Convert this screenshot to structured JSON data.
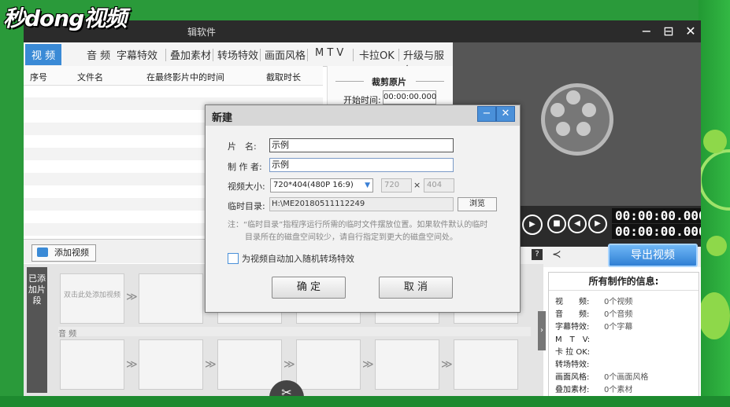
{
  "app": {
    "title": "(partial) 编辑软件",
    "title_visible": "辑软件",
    "logo": "秒d",
    "logo_text": "秒dong视频",
    "window_controls": [
      "−",
      "⊟",
      "✕"
    ]
  },
  "tabs": [
    {
      "label": "视 频",
      "active": true
    },
    {
      "label": "音 频"
    },
    {
      "label": "字幕特效"
    },
    {
      "label": "叠加素材"
    },
    {
      "label": "转场特效"
    },
    {
      "label": "画面风格"
    },
    {
      "label": "M T V"
    },
    {
      "label": "卡拉OK"
    },
    {
      "label": "升级与服务"
    }
  ],
  "video_list": {
    "columns": [
      "序号",
      "文件名",
      "在最终影片中的时间",
      "截取时长"
    ]
  },
  "clip_panel": {
    "title": "裁剪原片",
    "start_label": "开始时间:",
    "start_value": "00:00:00.000"
  },
  "player": {
    "timecode_1": "00:00:00.000",
    "timecode_2": "00:00:00.000"
  },
  "export_button": "导出视频",
  "add_video_button": "添加视频",
  "timeline": {
    "label": "已添加片段",
    "placeholder": "双击此处添加视频",
    "audio_label": "音 频"
  },
  "info": {
    "title": "所有制作的信息:",
    "rows": [
      {
        "k": "视　　频:",
        "v": "0个视频"
      },
      {
        "k": "音　　频:",
        "v": "0个音频"
      },
      {
        "k": "字幕特效:",
        "v": "0个字幕"
      },
      {
        "k": "M　T　V:",
        "v": ""
      },
      {
        "k": "卡 拉 OK:",
        "v": ""
      },
      {
        "k": "转场特效:",
        "v": ""
      },
      {
        "k": "画面风格:",
        "v": "0个画面风格"
      },
      {
        "k": "叠加素材:",
        "v": "0个素材"
      }
    ]
  },
  "dialog": {
    "title": "新建",
    "name_label": "片　名:",
    "name_value": "示例",
    "author_label": "制 作 者:",
    "author_value": "示例",
    "size_label": "视频大小:",
    "size_value": "720*404(480P 16:9)",
    "width_value": "720",
    "times": "×",
    "height_value": "404",
    "tempdir_label": "临时目录:",
    "tempdir_value": "H:\\ME20180511112249",
    "browse_button": "浏览",
    "note_line1": "注：“临时目录”指程序运行所需的临时文件摆放位置。如果软件默认的临时",
    "note_line2": "目录所在的磁盘空间较少，请自行指定到更大的磁盘空间处。",
    "checkbox_label": "为视频自动加入随机转场特效",
    "ok_button": "确 定",
    "cancel_button": "取 消",
    "minimize": "−",
    "close": "✕"
  }
}
